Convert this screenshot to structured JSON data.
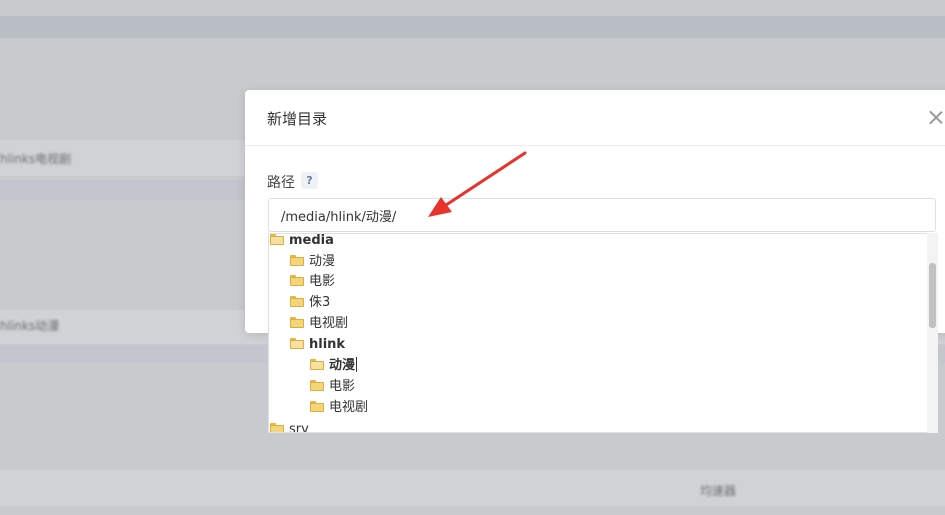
{
  "background": {
    "labels": [
      "hlinks电视剧",
      "hlinks动漫",
      "均速器"
    ]
  },
  "dialog": {
    "title": "新增目录",
    "field_label": "路径",
    "help_symbol": "?",
    "path_value": "/media/hlink/动漫/"
  },
  "tree": {
    "items": [
      {
        "label": "media",
        "icon": "folder-open-icon"
      },
      {
        "label": "动漫",
        "icon": "folder-icon"
      },
      {
        "label": "电影",
        "icon": "folder-icon"
      },
      {
        "label": "侏3",
        "icon": "folder-icon"
      },
      {
        "label": "电视剧",
        "icon": "folder-icon"
      },
      {
        "label": "hlink",
        "icon": "folder-open-icon"
      },
      {
        "label": "动漫",
        "icon": "folder-open-icon"
      },
      {
        "label": "电影",
        "icon": "folder-icon"
      },
      {
        "label": "电视剧",
        "icon": "folder-icon"
      },
      {
        "label": "srv",
        "icon": "folder-icon"
      }
    ]
  },
  "colors": {
    "annotation_arrow": "#e8322c",
    "folder": "#f5d57a"
  }
}
